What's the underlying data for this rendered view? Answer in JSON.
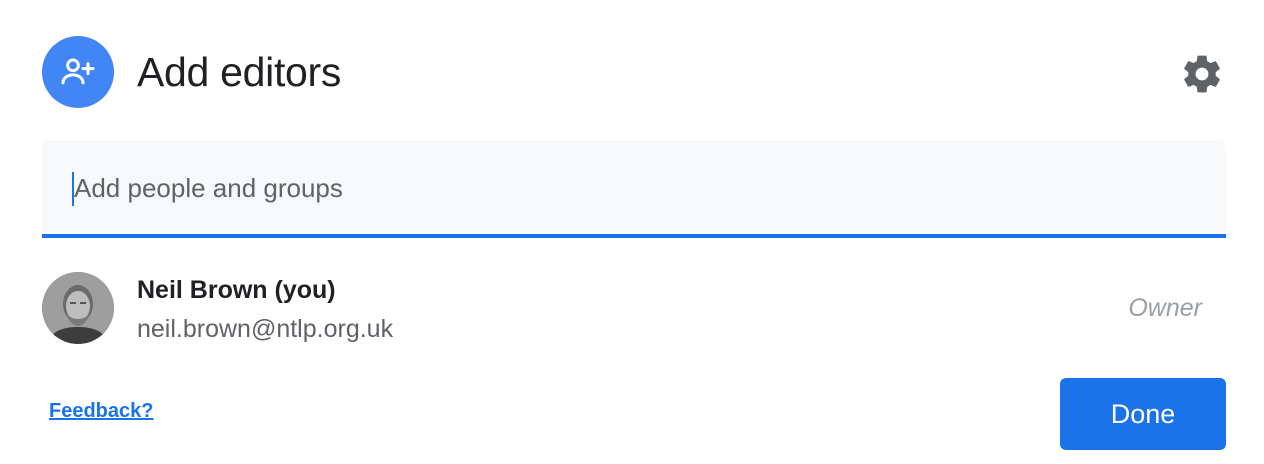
{
  "dialog": {
    "title": "Add editors",
    "header_icon": "person-add-icon",
    "settings_icon": "gear-icon",
    "accent_color": "#1a73e8",
    "header_icon_bg": "#4285f4"
  },
  "search": {
    "placeholder": "Add people and groups",
    "value": ""
  },
  "people": [
    {
      "name": "Neil Brown (you)",
      "email": "neil.brown@ntlp.org.uk",
      "role": "Owner",
      "avatar": "user-photo"
    }
  ],
  "footer": {
    "feedback_label": "Feedback?",
    "done_label": "Done"
  }
}
